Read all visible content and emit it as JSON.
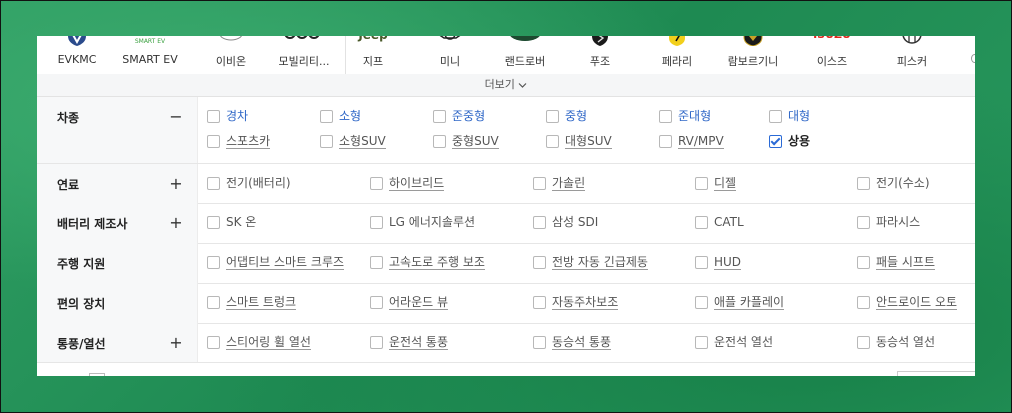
{
  "brands": [
    {
      "name": "EVKMC",
      "logo": "shield-logo"
    },
    {
      "name": "SMART EV",
      "logo": "smart-ev-logo",
      "logo_text": "SMART EV"
    },
    {
      "name": "이비온",
      "logo": "ev-circle-logo"
    },
    {
      "name": "모빌리티...",
      "logo": "mobility-logo"
    },
    {
      "name": "지프",
      "logo": "jeep-logo",
      "logo_text": "Jeep"
    },
    {
      "name": "미니",
      "logo": "mini-wing-logo"
    },
    {
      "name": "랜드로버",
      "logo": "land-rover-oval-logo"
    },
    {
      "name": "푸조",
      "logo": "peugeot-lion-logo"
    },
    {
      "name": "페라리",
      "logo": "ferrari-horse-logo"
    },
    {
      "name": "람보르기니",
      "logo": "lamborghini-bull-logo"
    },
    {
      "name": "이스즈",
      "logo": "isuzu-logo",
      "logo_text": "ISUZU"
    },
    {
      "name": "피스커",
      "logo": "fisker-logo"
    }
  ],
  "more_label": "더보기",
  "filters": [
    {
      "title": "차종",
      "toggle": "−",
      "options": [
        {
          "label": "경차",
          "checked": false,
          "style": "blue"
        },
        {
          "label": "소형",
          "checked": false,
          "style": "blue"
        },
        {
          "label": "준중형",
          "checked": false,
          "style": "blue"
        },
        {
          "label": "중형",
          "checked": false,
          "style": "blue"
        },
        {
          "label": "준대형",
          "checked": false,
          "style": "blue"
        },
        {
          "label": "대형",
          "checked": false,
          "style": "blue"
        },
        {
          "label": "스포츠카",
          "checked": false,
          "style": "u"
        },
        {
          "label": "소형SUV",
          "checked": false,
          "style": "u"
        },
        {
          "label": "중형SUV",
          "checked": false,
          "style": "u"
        },
        {
          "label": "대형SUV",
          "checked": false,
          "style": "u"
        },
        {
          "label": "RV/MPV",
          "checked": false,
          "style": "u"
        },
        {
          "label": "상용",
          "checked": true,
          "style": "sel"
        }
      ]
    },
    {
      "title": "연료",
      "toggle": "+",
      "options": [
        {
          "label": "전기(배터리)",
          "checked": false,
          "style": "nou"
        },
        {
          "label": "하이브리드",
          "checked": false,
          "style": "u"
        },
        {
          "label": "가솔린",
          "checked": false,
          "style": "u"
        },
        {
          "label": "디젤",
          "checked": false,
          "style": "u"
        },
        {
          "label": "전기(수소)",
          "checked": false,
          "style": "nou"
        }
      ]
    },
    {
      "title": "배터리 제조사",
      "toggle": "+",
      "options": [
        {
          "label": "SK 온",
          "checked": false,
          "style": "nou"
        },
        {
          "label": "LG 에너지솔루션",
          "checked": false,
          "style": "nou"
        },
        {
          "label": "삼성 SDI",
          "checked": false,
          "style": "nou"
        },
        {
          "label": "CATL",
          "checked": false,
          "style": "nou"
        },
        {
          "label": "파라시스",
          "checked": false,
          "style": "nou"
        }
      ]
    },
    {
      "title": "주행 지원",
      "toggle": "",
      "options": [
        {
          "label": "어댑티브 스마트 크루즈",
          "checked": false,
          "style": "u"
        },
        {
          "label": "고속도로 주행 보조",
          "checked": false,
          "style": "u"
        },
        {
          "label": "전방 자동 긴급제동",
          "checked": false,
          "style": "u"
        },
        {
          "label": "HUD",
          "checked": false,
          "style": "u"
        },
        {
          "label": "패들 시프트",
          "checked": false,
          "style": "u"
        }
      ]
    },
    {
      "title": "편의 장치",
      "toggle": "",
      "options": [
        {
          "label": "스마트 트렁크",
          "checked": false,
          "style": "u"
        },
        {
          "label": "어라운드 뷰",
          "checked": false,
          "style": "u"
        },
        {
          "label": "자동주차보조",
          "checked": false,
          "style": "u"
        },
        {
          "label": "애플 카플레이",
          "checked": false,
          "style": "u"
        },
        {
          "label": "안드로이드 오토",
          "checked": false,
          "style": "u"
        }
      ]
    },
    {
      "title": "통풍/열선",
      "toggle": "+",
      "options": [
        {
          "label": "스티어링 휠 열선",
          "checked": false,
          "style": "u"
        },
        {
          "label": "운전석 통풍",
          "checked": false,
          "style": "u"
        },
        {
          "label": "동승석 통풍",
          "checked": false,
          "style": "u"
        },
        {
          "label": "운전석 열선",
          "checked": false,
          "style": "nou"
        },
        {
          "label": "동승석 열선",
          "checked": false,
          "style": "nou"
        }
      ]
    }
  ]
}
